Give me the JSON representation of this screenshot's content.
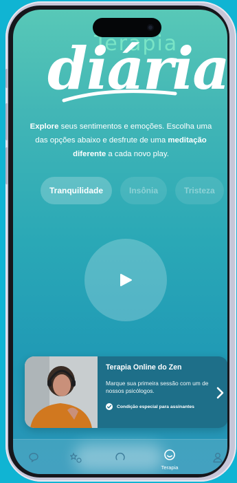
{
  "app": {
    "logo_small": "Terapia",
    "logo_big": "diária"
  },
  "description": {
    "explore": "Explore",
    "part1": " seus sentimentos e emoções. Escolha uma das opções abaixo e desfrute de uma ",
    "highlight": "meditação diferente",
    "part2": " a cada novo play."
  },
  "chips": [
    {
      "label": "Tranquilidade",
      "active": true
    },
    {
      "label": "Insônia",
      "active": false
    },
    {
      "label": "Tristeza",
      "active": false
    }
  ],
  "player": {
    "icon": "play-icon"
  },
  "card": {
    "title": "Terapia Online do Zen",
    "subtitle": "Marque sua primeira sessão com um de nossos psicólogos.",
    "badge": "Condição especial para assinantes"
  },
  "tabbar": {
    "items": [
      {
        "icon": "chat-bubble-icon"
      },
      {
        "icon": "star-shapes-icon"
      },
      {
        "icon": "circle-loop-icon"
      },
      {
        "icon": "smile-icon",
        "label": "Terapia",
        "active": true
      },
      {
        "icon": "user-icon"
      }
    ]
  },
  "colors": {
    "background": "#10b4d3",
    "screen_top": "#58c8b7",
    "screen_bottom": "#2a95b8",
    "card": "#1e6f89"
  }
}
